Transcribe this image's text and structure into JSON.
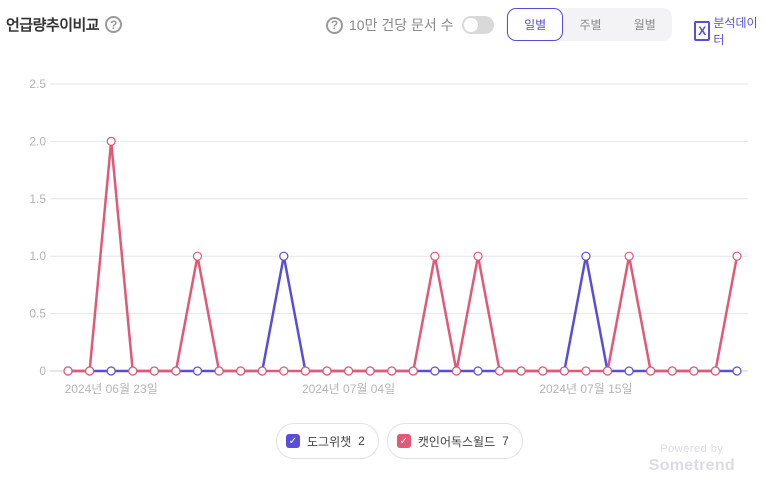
{
  "header": {
    "title": "언급량추이비교",
    "help_icon": "?",
    "normalize_help_icon": "?",
    "normalize_label": "10만 건당 문서 수",
    "normalize_on": false,
    "period_tabs": [
      "일별",
      "주별",
      "월별"
    ],
    "active_period": 0,
    "export_icon": "X",
    "export_label": "분석데이터"
  },
  "chart_data": {
    "type": "line",
    "x": [
      "2024-06-20",
      "2024-06-21",
      "2024-06-22",
      "2024-06-23",
      "2024-06-24",
      "2024-06-25",
      "2024-06-26",
      "2024-06-27",
      "2024-06-28",
      "2024-06-29",
      "2024-06-30",
      "2024-07-01",
      "2024-07-02",
      "2024-07-03",
      "2024-07-04",
      "2024-07-05",
      "2024-07-06",
      "2024-07-07",
      "2024-07-08",
      "2024-07-09",
      "2024-07-10",
      "2024-07-11",
      "2024-07-12",
      "2024-07-13",
      "2024-07-14",
      "2024-07-15",
      "2024-07-16",
      "2024-07-17",
      "2024-07-18",
      "2024-07-19",
      "2024-07-20",
      "2024-07-21"
    ],
    "x_tick_labels": [
      {
        "index": 2,
        "label": "2024년 06월 23일"
      },
      {
        "index": 13,
        "label": "2024년 07월 04일"
      },
      {
        "index": 24,
        "label": "2024년 07월 15일"
      }
    ],
    "ylim": [
      0,
      2.5
    ],
    "y_ticks": [
      "0",
      "0.5",
      "1.0",
      "1.5",
      "2.0",
      "2.5"
    ],
    "y_tick_values": [
      0,
      0.5,
      1,
      1.5,
      2,
      2.5
    ],
    "grid": true,
    "legend_position": "bottom",
    "series": [
      {
        "name": "도그위챗",
        "total": "2",
        "color": "#5b4ed6",
        "values": [
          0,
          0,
          0,
          0,
          0,
          0,
          0,
          0,
          0,
          0,
          1,
          0,
          0,
          0,
          0,
          0,
          0,
          0,
          0,
          0,
          0,
          0,
          0,
          0,
          1,
          0,
          0,
          0,
          0,
          0,
          0,
          0
        ]
      },
      {
        "name": "캣인어독스윌드",
        "total": "7",
        "color": "#e05a78",
        "values": [
          0,
          0,
          2,
          0,
          0,
          0,
          1,
          0,
          0,
          0,
          0,
          0,
          0,
          0,
          0,
          0,
          0,
          1,
          0,
          1,
          0,
          0,
          0,
          0,
          0,
          0,
          1,
          0,
          0,
          0,
          0,
          1
        ]
      }
    ]
  },
  "footer": {
    "powered_by": "Powered by",
    "brand": "Sometrend"
  }
}
